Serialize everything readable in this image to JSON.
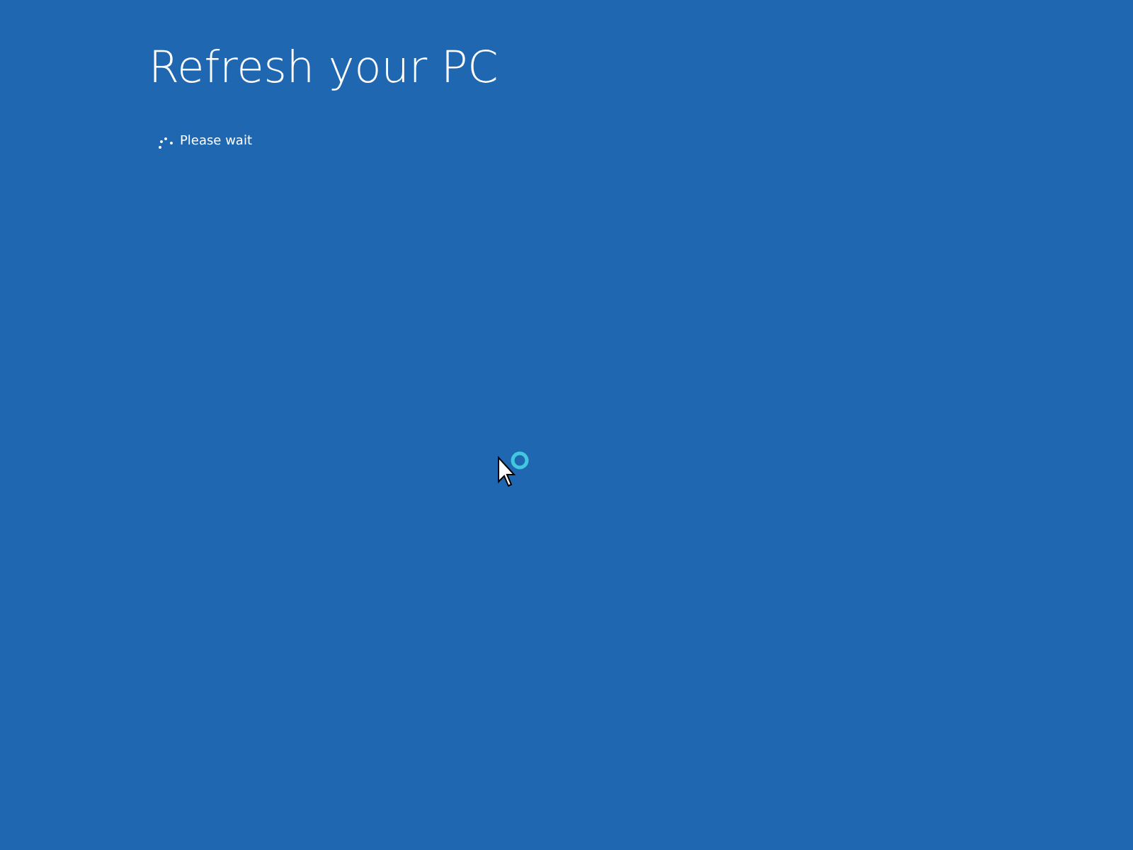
{
  "title": "Refresh your PC",
  "status": {
    "text": "Please wait"
  }
}
